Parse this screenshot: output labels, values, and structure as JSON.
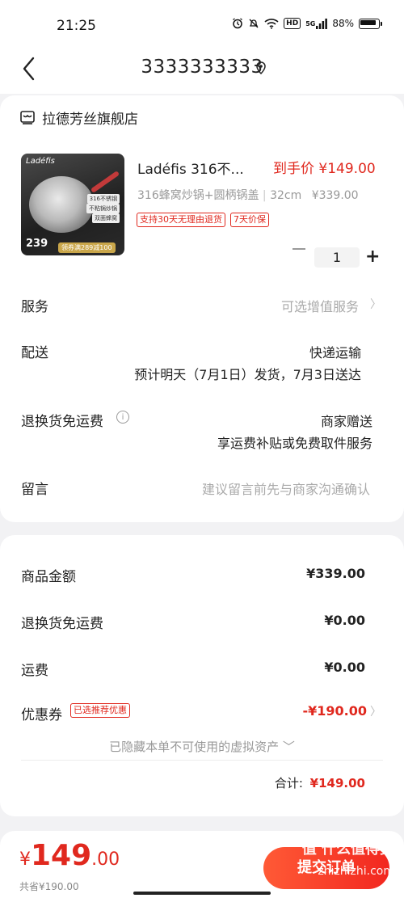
{
  "status_bar": {
    "time": "21:25",
    "network": "5G",
    "hd": "HD",
    "battery": "88%"
  },
  "header": {
    "title": "3333333333"
  },
  "store": {
    "name": "拉德芳丝旗舰店"
  },
  "product": {
    "name": "Ladéfis 316不...",
    "price_label": "到手价 ¥149.00",
    "spec": "316蜂窝炒锅+圆柄锅盖",
    "spec_size": "32cm",
    "orig_price": "¥339.00",
    "tags": [
      "支持30天无理由退货",
      "7天价保"
    ],
    "quantity": "1",
    "thumb": {
      "brand": "Ladéfis",
      "badges": [
        "316不锈钢",
        "不粘锅炒锅",
        "双面蜂窝"
      ],
      "price": "239",
      "coupon": "领券满289减100"
    }
  },
  "rows": {
    "service": {
      "label": "服务",
      "value": "可选增值服务"
    },
    "delivery": {
      "label": "配送",
      "value": "快递运输",
      "detail": "预计明天（7月1日）发货，7月3日送达"
    },
    "return_shipping": {
      "label": "退换货免运费",
      "value": "商家赠送",
      "detail": "享运费补贴或免费取件服务"
    },
    "note": {
      "label": "留言",
      "placeholder": "建议留言前先与商家沟通确认"
    }
  },
  "summary": {
    "goods_label": "商品金额",
    "goods_value": "¥339.00",
    "return_label": "退换货免运费",
    "return_value": "¥0.00",
    "shipping_label": "运费",
    "shipping_value": "¥0.00",
    "coupon_label": "优惠券",
    "coupon_tag": "已选推荐优惠",
    "coupon_value": "-¥190.00",
    "hidden_assets": "已隐藏本单不可使用的虚拟资产",
    "total_label": "合计:",
    "total_value": "¥149.00"
  },
  "footer": {
    "currency": "¥",
    "amount_int": "149",
    "amount_dec": ".00",
    "saved": "共省¥190.00",
    "submit_label": "提交订单"
  },
  "watermark": {
    "top": "值 什么值得买",
    "bottom": "zhizhizhi.com"
  },
  "colors": {
    "accent_red": "#e0281e",
    "background": "#f2f2f4"
  }
}
